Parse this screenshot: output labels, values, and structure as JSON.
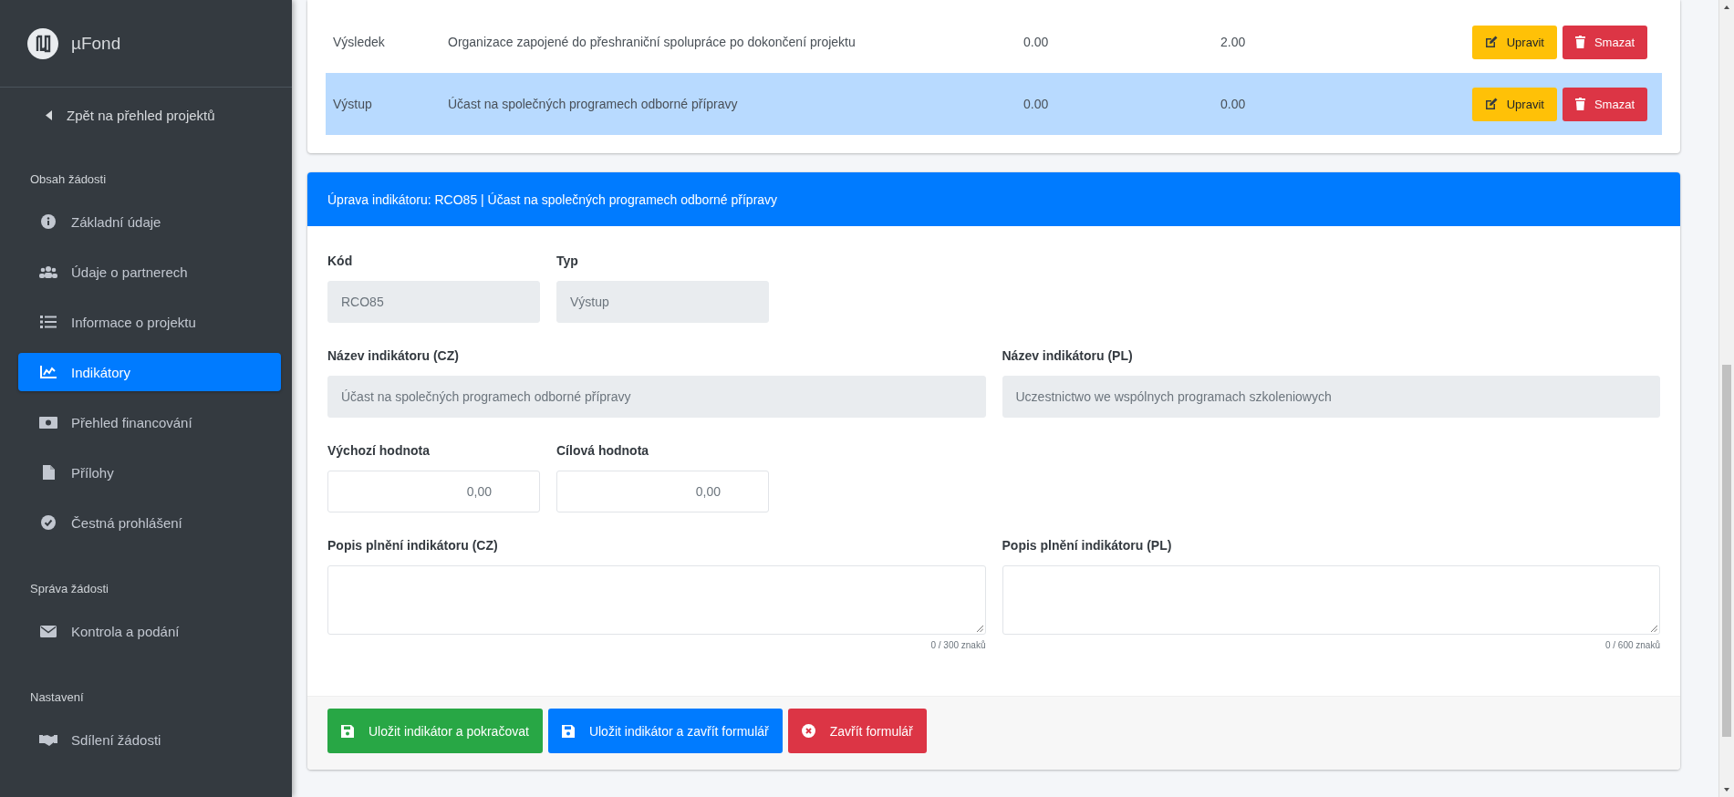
{
  "sidebar": {
    "brand": "µFond",
    "back_link": "Zpět na přehled projektů",
    "sections": [
      {
        "title": "Obsah žádosti",
        "items": [
          {
            "label": "Základní údaje",
            "selected": false
          },
          {
            "label": "Údaje o partnerech",
            "selected": false
          },
          {
            "label": "Informace o projektu",
            "selected": false
          },
          {
            "label": "Indikátory",
            "selected": true
          },
          {
            "label": "Přehled financování",
            "selected": false
          },
          {
            "label": "Přílohy",
            "selected": false
          },
          {
            "label": "Čestná prohlášení",
            "selected": false
          }
        ]
      },
      {
        "title": "Správa žádosti",
        "items": [
          {
            "label": "Kontrola a podání",
            "selected": false
          }
        ]
      },
      {
        "title": "Nastavení",
        "items": [
          {
            "label": "Sdílení žádosti",
            "selected": false
          }
        ]
      }
    ]
  },
  "table": {
    "rows": [
      {
        "type": "Výsledek",
        "name": "Organizace zapojené do přeshraniční spolupráce po dokončení projektu",
        "baseline": "0.00",
        "target": "2.00",
        "selected": false,
        "actions": [
          {
            "label": "Upravit",
            "kind": "edit"
          },
          {
            "label": "Smazat",
            "kind": "delete"
          }
        ]
      },
      {
        "type": "Výstup",
        "name": "Účast na společných programech odborné přípravy",
        "baseline": "0.00",
        "target": "0.00",
        "selected": true,
        "actions": [
          {
            "label": "Upravit",
            "kind": "edit"
          },
          {
            "label": "Smazat",
            "kind": "delete"
          }
        ]
      }
    ]
  },
  "form": {
    "title": "Úprava indikátoru: RCO85 | Účast na společných programech odborné přípravy",
    "rows": [
      [
        {
          "label": "Kód",
          "kind": "code",
          "value": "RCO85"
        },
        {
          "label": "Typ",
          "kind": "code",
          "value": "Výstup"
        }
      ],
      [
        {
          "label": "Název indikátoru (CZ)",
          "kind": "text",
          "value": "Účast na společných programech odborné přípravy"
        },
        {
          "label": "Název indikátoru (PL)",
          "kind": "text",
          "value": "Uczestnictwo we wspólnych programach szkoleniowych"
        }
      ],
      [
        {
          "label": "Výchozí hodnota",
          "kind": "number",
          "value": "0,00"
        },
        {
          "label": "Cílová hodnota",
          "kind": "number",
          "value": "0,00"
        }
      ],
      [
        {
          "label": "Popis plnění indikátoru (CZ)",
          "kind": "textarea",
          "counter": "0 / 300 znaků"
        },
        {
          "label": "Popis plnění indikátoru (PL)",
          "kind": "textarea",
          "counter": "0 / 600 znaků"
        }
      ]
    ],
    "buttons": [
      {
        "label": "Uložit indikátor a pokračovat",
        "kind": "success"
      },
      {
        "label": "Uložit indikátor a zavřít formulář",
        "kind": "primary"
      },
      {
        "label": "Zavřít formulář",
        "kind": "danger"
      }
    ]
  }
}
